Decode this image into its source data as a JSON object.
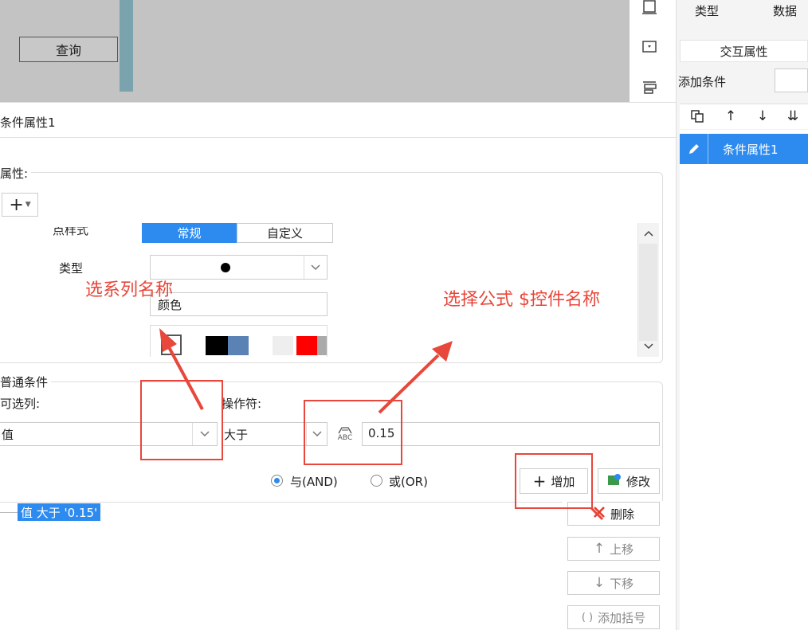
{
  "preview": {
    "query_button": "查询"
  },
  "right_panel": {
    "tab_type": "类型",
    "tab_data": "数据",
    "interact_attr": "交互属性",
    "add_condition": "添加条件",
    "selected_item": "条件属性1"
  },
  "dialog": {
    "title": "条件属性1",
    "attr_section": "属性:",
    "point_style_label": "点样式",
    "style_normal": "常规",
    "style_custom": "自定义",
    "type_label": "类型",
    "color_value": "颜色",
    "palette": [
      "#000000",
      "#5a82b4",
      "#ffffff",
      "#eeeeee",
      "#ff0000",
      "#aaaaaa"
    ],
    "normal_conditions": "普通条件",
    "column_label": "可选列:",
    "operator_label": "操作符:",
    "column_value": "值",
    "operator_value": "大于",
    "abc_icon_text": "ABC",
    "value": "0.15",
    "radio_and": "与(AND)",
    "radio_or": "或(OR)",
    "btn_add": "增加",
    "btn_edit": "修改",
    "btn_delete": "删除",
    "btn_up": "上移",
    "btn_down": "下移",
    "btn_bracket": "添加括号",
    "condition_item": "值 大于 '0.15'"
  },
  "annotations": {
    "series_note": "选系列名称",
    "formula_note": "选择公式  $控件名称",
    "accent_color": "#e8473b"
  }
}
